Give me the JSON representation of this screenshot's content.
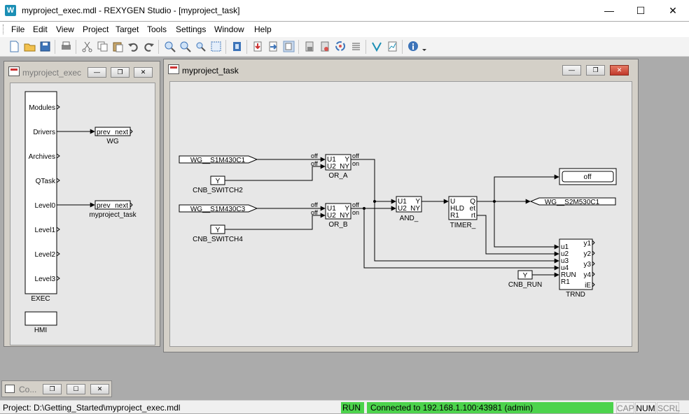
{
  "window": {
    "title": "myproject_exec.mdl - REXYGEN Studio - [myproject_task]",
    "icon_letter": "W",
    "controls": {
      "minimize": "—",
      "maximize": "☐",
      "close": "✕"
    }
  },
  "menu": [
    "File",
    "Edit",
    "View",
    "Project",
    "Target",
    "Tools",
    "Settings",
    "Window",
    "Help"
  ],
  "toolbar_icons": [
    "new-file-icon",
    "open-folder-icon",
    "save-icon",
    "print-icon",
    "cut-icon",
    "copy-icon",
    "paste-icon",
    "undo-icon",
    "redo-icon",
    "zoom-in-icon",
    "zoom-out-icon",
    "zoom-fit-icon",
    "zoom-select-icon",
    "compile-icon",
    "download-icon",
    "upload-icon",
    "diagnostics-icon",
    "block-a-icon",
    "block-b-icon",
    "refresh-icon",
    "list-icon",
    "watch-icon",
    "trend-icon",
    "info-icon"
  ],
  "exec_window": {
    "title": "myproject_exec",
    "block": {
      "name": "EXEC",
      "ports": [
        "Modules",
        "Drivers",
        "Archives",
        "QTask",
        "Level0",
        "Level1",
        "Level2",
        "Level3"
      ]
    },
    "wg_block": {
      "left_port": "prev",
      "right_port": "next",
      "name": "WG"
    },
    "task_block": {
      "left_port": "prev",
      "right_port": "next",
      "name": "myproject_task"
    },
    "hmi_block": {
      "name": "HMI"
    }
  },
  "task_window": {
    "title": "myproject_task",
    "inputs": [
      {
        "label": "WG__S1M430C1"
      },
      {
        "label": "WG__S1M430C3"
      }
    ],
    "constants": [
      {
        "value": "Y",
        "name": "CNB_SWITCH2"
      },
      {
        "value": "Y",
        "name": "CNB_SWITCH4"
      },
      {
        "value": "Y",
        "name": "CNB_RUN"
      }
    ],
    "or_a": {
      "name": "OR_A",
      "in1": "U1",
      "in2": "U2",
      "out1": "Y",
      "out2": "NY",
      "val_in1": "off",
      "val_in2": "off",
      "val_out1": "off",
      "val_out2": "on"
    },
    "or_b": {
      "name": "OR_B",
      "in1": "U1",
      "in2": "U2",
      "out1": "Y",
      "out2": "NY",
      "val_in1": "off",
      "val_in2": "off",
      "val_out1": "off",
      "val_out2": "on"
    },
    "and_block": {
      "name": "AND_",
      "in1": "U1",
      "in2": "U2",
      "out1": "Y",
      "out2": "NY"
    },
    "timer": {
      "name": "TIMER_",
      "in1": "U",
      "in2": "HLD",
      "in3": "R1",
      "out1": "Q",
      "out2": "et",
      "out3": "rt"
    },
    "display": {
      "value": "off"
    },
    "output": {
      "label": "WG__S2M530C1"
    },
    "trnd": {
      "name": "TRND",
      "inputs": [
        "u1",
        "u2",
        "u3",
        "u4",
        "RUN",
        "R1"
      ],
      "outputs": [
        "y1",
        "y2",
        "y3",
        "y4",
        "iE"
      ]
    }
  },
  "minimized_window": {
    "title": "Co..."
  },
  "status": {
    "project": "Project: D:\\Getting_Started\\myproject_exec.mdl",
    "run": "RUN",
    "connection": "Connected to 192.168.1.100:43981 (admin)",
    "cap": "CAP",
    "num": "NUM",
    "scrl": "SCRL"
  },
  "colors": {
    "run_green": "#4cd34c",
    "close_red": "#c0392b",
    "canvas": "#e7e7e7",
    "mdi_bg": "#d4d0c8"
  }
}
